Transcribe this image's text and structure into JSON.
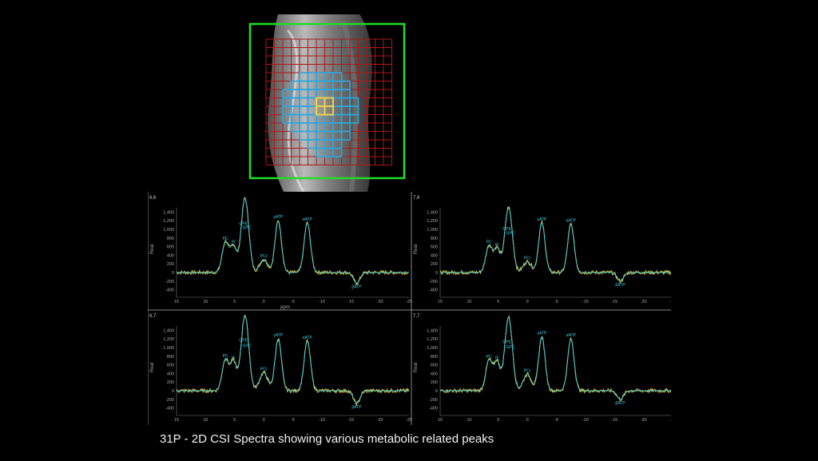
{
  "mri": {
    "roi_color": "#22dd22",
    "grid_color": "#b01818",
    "voxel_color": "#2aa7e0",
    "selected_voxel_color": "#e8d24a"
  },
  "caption": "31P - 2D CSI Spectra showing various metabolic related peaks",
  "chart_data": {
    "type": "line",
    "panels": [
      {
        "label": "6,6",
        "ylabel": "Real",
        "xlabel": "ppm",
        "x": [
          15,
          10,
          5,
          0,
          -5,
          -10,
          -15,
          -20,
          -25
        ],
        "y_ticks": [
          "1,400",
          "1,200",
          "1,000",
          "800",
          "600",
          "400",
          "200",
          "0",
          "-200",
          "-400"
        ],
        "ylim": [
          -500,
          1500
        ],
        "xlim": [
          15,
          -25
        ],
        "peaks": [
          {
            "name": "Pi",
            "ppm": 5.2,
            "height": 620
          },
          {
            "name": "PC",
            "ppm": 6.6,
            "height": 700
          },
          {
            "name": "GPE",
            "ppm": 3.5,
            "height": 1050
          },
          {
            "name": "GPC",
            "ppm": 2.9,
            "height": 950
          },
          {
            "name": "PCr",
            "ppm": 0.0,
            "height": 300
          },
          {
            "name": "γATP",
            "ppm": -2.5,
            "height": 1200
          },
          {
            "name": "αATP",
            "ppm": -7.5,
            "height": 1150
          },
          {
            "name": "βATP",
            "ppm": -16.0,
            "height": -250
          }
        ]
      },
      {
        "label": "7,6",
        "ylabel": "Real",
        "xlabel": "",
        "x": [
          15,
          10,
          5,
          0,
          -5,
          -10,
          -15,
          -20,
          -25
        ],
        "y_ticks": [
          "1,400",
          "1,200",
          "1,000",
          "800",
          "600",
          "400",
          "200",
          "0",
          "-200",
          "-400"
        ],
        "ylim": [
          -500,
          1500
        ],
        "xlim": [
          15,
          -25
        ],
        "peaks": [
          {
            "name": "Pi",
            "ppm": 5.2,
            "height": 560
          },
          {
            "name": "PC",
            "ppm": 6.6,
            "height": 620
          },
          {
            "name": "GPE",
            "ppm": 3.5,
            "height": 930
          },
          {
            "name": "GPC",
            "ppm": 2.9,
            "height": 820
          },
          {
            "name": "PCr",
            "ppm": 0.0,
            "height": 250
          },
          {
            "name": "γATP",
            "ppm": -2.5,
            "height": 1150
          },
          {
            "name": "αATP",
            "ppm": -7.5,
            "height": 1120
          },
          {
            "name": "βATP",
            "ppm": -16.0,
            "height": -200
          }
        ]
      },
      {
        "label": "6,7",
        "ylabel": "Real",
        "xlabel": "",
        "x": [
          15,
          10,
          5,
          0,
          -5,
          -10,
          -15,
          -20,
          -25
        ],
        "y_ticks": [
          "1,400",
          "1,200",
          "1,000",
          "800",
          "600",
          "400",
          "200",
          "0",
          "-200",
          "-400"
        ],
        "ylim": [
          -500,
          1500
        ],
        "xlim": [
          15,
          -25
        ],
        "peaks": [
          {
            "name": "Pi",
            "ppm": 5.2,
            "height": 680
          },
          {
            "name": "PC",
            "ppm": 6.6,
            "height": 720
          },
          {
            "name": "GPE",
            "ppm": 3.5,
            "height": 1080
          },
          {
            "name": "GPC",
            "ppm": 2.9,
            "height": 950
          },
          {
            "name": "PCr",
            "ppm": 0.0,
            "height": 420
          },
          {
            "name": "γATP",
            "ppm": -2.5,
            "height": 1200
          },
          {
            "name": "αATP",
            "ppm": -7.5,
            "height": 1150
          },
          {
            "name": "βATP",
            "ppm": -16.0,
            "height": -300
          }
        ]
      },
      {
        "label": "7,7",
        "ylabel": "Real",
        "xlabel": "",
        "x": [
          15,
          10,
          5,
          0,
          -5,
          -10,
          -15,
          -20,
          -25
        ],
        "y_ticks": [
          "1,400",
          "1,200",
          "1,000",
          "800",
          "600",
          "400",
          "200",
          "0",
          "-200",
          "-400"
        ],
        "ylim": [
          -500,
          1500
        ],
        "xlim": [
          15,
          -25
        ],
        "peaks": [
          {
            "name": "Pi",
            "ppm": 5.2,
            "height": 680
          },
          {
            "name": "PC",
            "ppm": 6.6,
            "height": 700
          },
          {
            "name": "GPE",
            "ppm": 3.5,
            "height": 1050
          },
          {
            "name": "GPC",
            "ppm": 2.9,
            "height": 930
          },
          {
            "name": "PCr",
            "ppm": 0.0,
            "height": 380
          },
          {
            "name": "γATP",
            "ppm": -2.5,
            "height": 1250
          },
          {
            "name": "αATP",
            "ppm": -7.5,
            "height": 1200
          },
          {
            "name": "βATP",
            "ppm": -16.0,
            "height": -200
          }
        ]
      }
    ]
  }
}
